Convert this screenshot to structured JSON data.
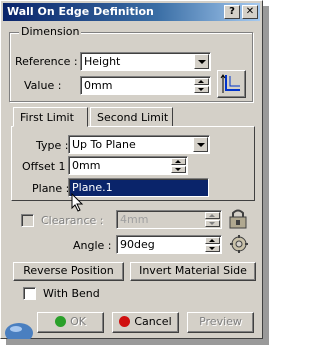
{
  "window": {
    "title": "Wall On Edge Definition",
    "help_label": "?",
    "close_label": "✕"
  },
  "dimension": {
    "legend": "Dimension",
    "reference_label": "Reference :",
    "reference_value": "Height",
    "value_label": "Value :",
    "value_value": "0mm"
  },
  "tabs": [
    {
      "label": "First Limit"
    },
    {
      "label": "Second Limit"
    }
  ],
  "first_limit": {
    "type_label": "Type :",
    "type_value": "Up To Plane",
    "offset_label": "Offset 1 :",
    "offset_value": "0mm",
    "plane_label": "Plane :",
    "plane_value": "Plane.1"
  },
  "clearance": {
    "label": "Clearance :",
    "value": "4mm",
    "checked": false
  },
  "angle": {
    "label": "Angle :",
    "value": "90deg"
  },
  "buttons": {
    "reverse_position": "Reverse Position",
    "invert_material": "Invert Material Side",
    "ok": "OK",
    "cancel": "Cancel",
    "preview": "Preview"
  },
  "with_bend": {
    "label": "With Bend",
    "checked": false
  },
  "colors": {
    "title_start": "#0a246a",
    "ok_dot": "#2aa02a",
    "cancel_dot": "#d01010",
    "selection": "#0a246a"
  }
}
